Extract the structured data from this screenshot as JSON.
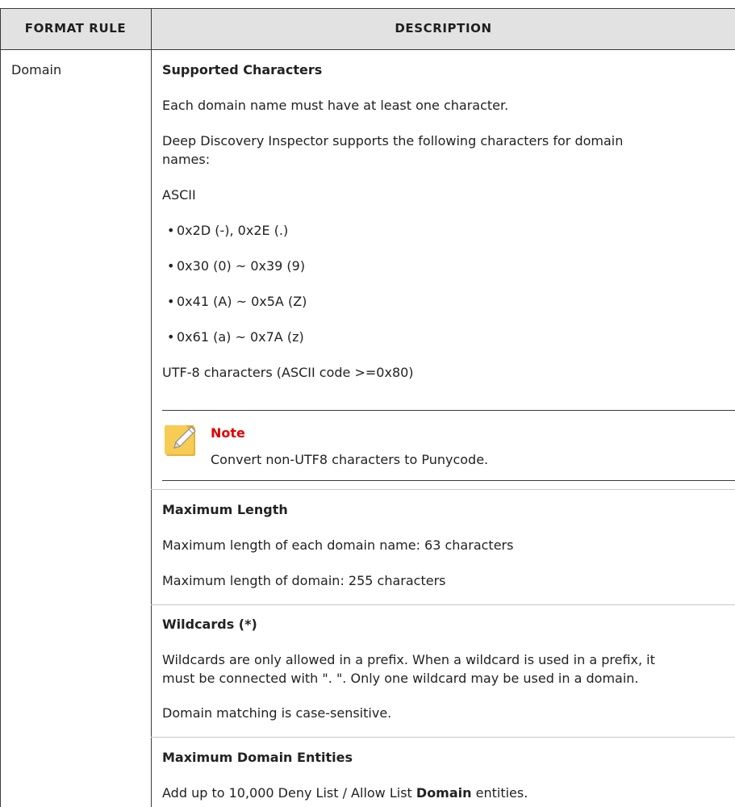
{
  "header": {
    "format_rule": "FORMAT RULE",
    "description": "DESCRIPTION"
  },
  "row": {
    "format_rule": "Domain",
    "sections": {
      "supported": {
        "heading": "Supported Characters",
        "p1": "Each domain name must have at least one character.",
        "p2_line1": "Deep Discovery Inspector supports the following characters for domain",
        "p2_line2": "names:",
        "ascii_label": "ASCII",
        "ascii_items": [
          "0x2D (-), 0x2E (.)",
          "0x30 (0) ~ 0x39 (9)",
          "0x41 (A) ~ 0x5A (Z)",
          "0x61 (a) ~ 0x7A (z)"
        ],
        "utf8": "UTF-8 characters (ASCII code >=0x80)",
        "note_title": "Note",
        "note_text": "Convert non-UTF8 characters to Punycode."
      },
      "max_length": {
        "heading": "Maximum Length",
        "p1": "Maximum length of each domain name: 63 characters",
        "p2": "Maximum length of domain: 255 characters"
      },
      "wildcards": {
        "heading": "Wildcards (*)",
        "p1_line1": "Wildcards are only allowed in a prefix. When a wildcard is used in a prefix, it",
        "p1_line2": "must be connected with \". \". Only one wildcard may be used in a domain.",
        "p2": "Domain matching is case-sensitive."
      },
      "entities": {
        "heading": "Maximum Domain Entities",
        "text_before": "Add up to 10,000 Deny List / Allow List ",
        "text_bold": "Domain",
        "text_after": " entities."
      }
    }
  },
  "colors": {
    "header_bg": "#e2e2e2",
    "border": "#3a3a3a",
    "note_title": "#e00000",
    "note_icon": "#f2c447"
  }
}
